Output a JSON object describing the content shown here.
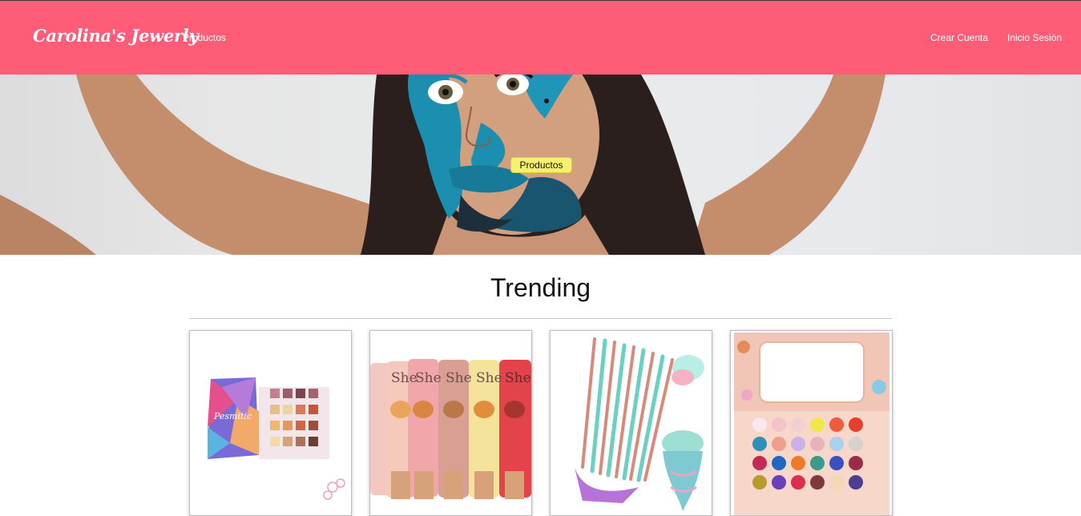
{
  "navbar": {
    "brand": "Carolina's Jewerly",
    "links": {
      "productos": "Productos",
      "crear_cuenta": "Crear Cuenta",
      "inicio_sesion": "Inicio Sesión"
    },
    "bg_color": "#ff5c77"
  },
  "hero": {
    "button_label": "Productos",
    "button_color": "#f6f070"
  },
  "trending": {
    "title": "Trending",
    "products": [
      {
        "name": "eyeshadow-palette-cosmetic"
      },
      {
        "name": "she-lip-gloss-set"
      },
      {
        "name": "mermaid-brush-set"
      },
      {
        "name": "glitter-eyeshadow-palette"
      }
    ]
  }
}
